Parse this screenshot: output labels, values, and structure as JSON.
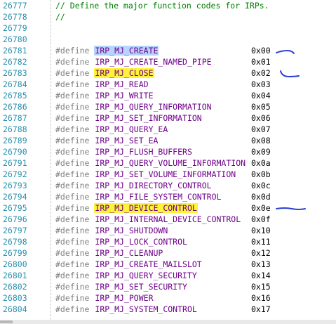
{
  "comment_lines": [
    {
      "num": "26777",
      "text": "// Define the major function codes for IRPs."
    },
    {
      "num": "26778",
      "text": "//"
    },
    {
      "num": "26779",
      "text": ""
    },
    {
      "num": "26780",
      "text": ""
    }
  ],
  "keyword": "#define",
  "define_lines": [
    {
      "num": "26781",
      "name": "IRP_MJ_CREATE",
      "value": "0x00",
      "highlight": "blue"
    },
    {
      "num": "26782",
      "name": "IRP_MJ_CREATE_NAMED_PIPE",
      "value": "0x01",
      "highlight": ""
    },
    {
      "num": "26783",
      "name": "IRP_MJ_CLOSE",
      "value": "0x02",
      "highlight": "yellow"
    },
    {
      "num": "26784",
      "name": "IRP_MJ_READ",
      "value": "0x03",
      "highlight": ""
    },
    {
      "num": "26785",
      "name": "IRP_MJ_WRITE",
      "value": "0x04",
      "highlight": ""
    },
    {
      "num": "26786",
      "name": "IRP_MJ_QUERY_INFORMATION",
      "value": "0x05",
      "highlight": ""
    },
    {
      "num": "26787",
      "name": "IRP_MJ_SET_INFORMATION",
      "value": "0x06",
      "highlight": ""
    },
    {
      "num": "26788",
      "name": "IRP_MJ_QUERY_EA",
      "value": "0x07",
      "highlight": ""
    },
    {
      "num": "26789",
      "name": "IRP_MJ_SET_EA",
      "value": "0x08",
      "highlight": ""
    },
    {
      "num": "26790",
      "name": "IRP_MJ_FLUSH_BUFFERS",
      "value": "0x09",
      "highlight": ""
    },
    {
      "num": "26791",
      "name": "IRP_MJ_QUERY_VOLUME_INFORMATION",
      "value": "0x0a",
      "highlight": ""
    },
    {
      "num": "26792",
      "name": "IRP_MJ_SET_VOLUME_INFORMATION",
      "value": "0x0b",
      "highlight": ""
    },
    {
      "num": "26793",
      "name": "IRP_MJ_DIRECTORY_CONTROL",
      "value": "0x0c",
      "highlight": ""
    },
    {
      "num": "26794",
      "name": "IRP_MJ_FILE_SYSTEM_CONTROL",
      "value": "0x0d",
      "highlight": ""
    },
    {
      "num": "26795",
      "name": "IRP_MJ_DEVICE_CONTROL",
      "value": "0x0e",
      "highlight": "yellow"
    },
    {
      "num": "26796",
      "name": "IRP_MJ_INTERNAL_DEVICE_CONTROL",
      "value": "0x0f",
      "highlight": ""
    },
    {
      "num": "26797",
      "name": "IRP_MJ_SHUTDOWN",
      "value": "0x10",
      "highlight": ""
    },
    {
      "num": "26798",
      "name": "IRP_MJ_LOCK_CONTROL",
      "value": "0x11",
      "highlight": ""
    },
    {
      "num": "26799",
      "name": "IRP_MJ_CLEANUP",
      "value": "0x12",
      "highlight": ""
    },
    {
      "num": "26800",
      "name": "IRP_MJ_CREATE_MAILSLOT",
      "value": "0x13",
      "highlight": ""
    },
    {
      "num": "26801",
      "name": "IRP_MJ_QUERY_SECURITY",
      "value": "0x14",
      "highlight": ""
    },
    {
      "num": "26802",
      "name": "IRP_MJ_SET_SECURITY",
      "value": "0x15",
      "highlight": ""
    },
    {
      "num": "26803",
      "name": "IRP_MJ_POWER",
      "value": "0x16",
      "highlight": ""
    },
    {
      "num": "26804",
      "name": "IRP_MJ_SYSTEM_CONTROL",
      "value": "0x17",
      "highlight": ""
    }
  ],
  "colors": {
    "comment": "#008000",
    "macro": "#6f008a",
    "line_number": "#2b91af",
    "keyword": "#808080",
    "annotation": "#2a3fd6"
  },
  "annotations": [
    "handwritten-underline-mark",
    "handwritten-underline-mark",
    "handwritten-underline-mark"
  ]
}
